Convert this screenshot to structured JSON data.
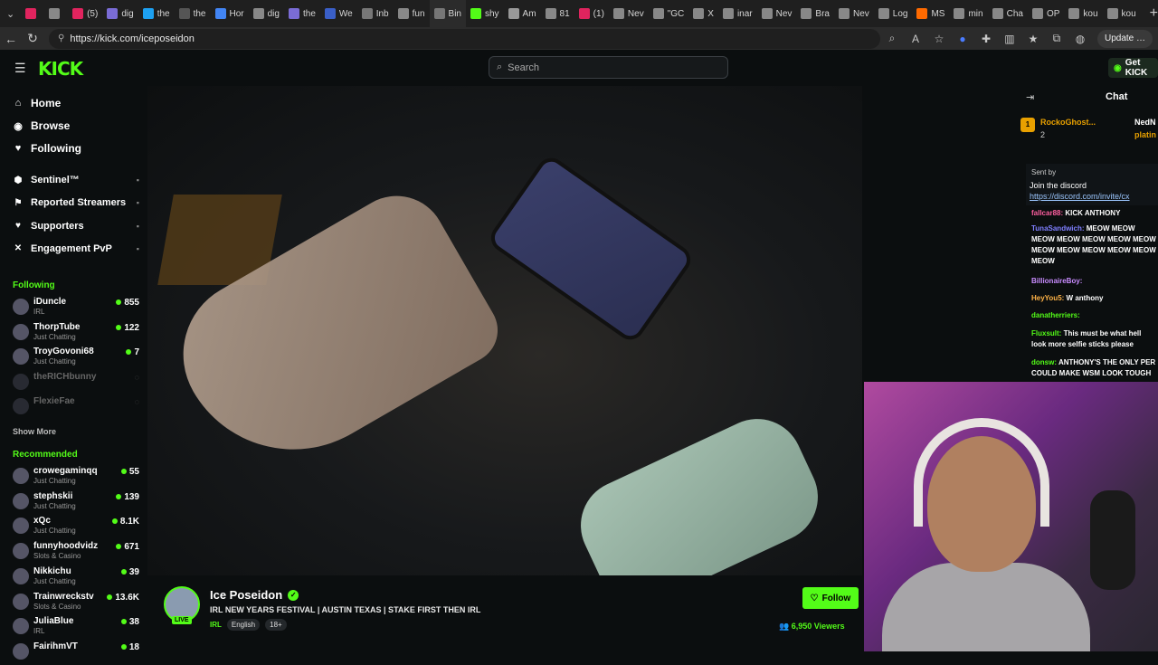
{
  "browser": {
    "tabs": [
      {
        "label": "",
        "color": "#e0245e"
      },
      {
        "label": "",
        "color": "#888"
      },
      {
        "label": "(5)",
        "color": "#e0245e"
      },
      {
        "label": "dig",
        "color": "#7a6cd6"
      },
      {
        "label": "the",
        "color": "#1da1f2"
      },
      {
        "label": "the",
        "color": "#555"
      },
      {
        "label": "Hor",
        "color": "#4285f4"
      },
      {
        "label": "dig",
        "color": "#888"
      },
      {
        "label": "the",
        "color": "#7a6cd6"
      },
      {
        "label": "We",
        "color": "#3a5fc8"
      },
      {
        "label": "Inb",
        "color": "#777"
      },
      {
        "label": "fun",
        "color": "#888"
      },
      {
        "label": "Bin",
        "color": "#777"
      },
      {
        "label": "shy",
        "color": "#53fc18"
      },
      {
        "label": "Am",
        "color": "#999"
      },
      {
        "label": "81",
        "color": "#888"
      },
      {
        "label": "(1)",
        "color": "#e0245e"
      },
      {
        "label": "Nev",
        "color": "#888"
      },
      {
        "label": "\"GC",
        "color": "#888"
      },
      {
        "label": "X",
        "color": "#888"
      },
      {
        "label": "inar",
        "color": "#888"
      },
      {
        "label": "Nev",
        "color": "#888"
      },
      {
        "label": "Bra",
        "color": "#888"
      },
      {
        "label": "Nev",
        "color": "#888"
      },
      {
        "label": "Log",
        "color": "#888"
      },
      {
        "label": "MS",
        "color": "#ff6a00"
      },
      {
        "label": "min",
        "color": "#888"
      },
      {
        "label": "Cha",
        "color": "#888"
      },
      {
        "label": "OP",
        "color": "#888"
      },
      {
        "label": "kou",
        "color": "#888"
      },
      {
        "label": "kou",
        "color": "#888"
      }
    ],
    "url": "https://kick.com/iceposeidon",
    "update_label": "Update"
  },
  "header": {
    "logo": "KICK",
    "search_placeholder": "Search",
    "get_kick_label": "Get KICK"
  },
  "sidebar": {
    "nav": [
      {
        "label": "Home",
        "icon": "home-icon",
        "glyph": "⌂"
      },
      {
        "label": "Browse",
        "icon": "browse-icon",
        "glyph": "◉"
      },
      {
        "label": "Following",
        "icon": "heart-icon",
        "glyph": "♥"
      }
    ],
    "special": [
      {
        "label": "Sentinel™",
        "glyph": "⬢"
      },
      {
        "label": "Reported Streamers",
        "glyph": "⚑"
      },
      {
        "label": "Supporters",
        "glyph": "♥"
      },
      {
        "label": "Engagement PvP",
        "glyph": "✕"
      }
    ],
    "following_header": "Following",
    "following": [
      {
        "name": "iDuncle",
        "category": "IRL",
        "viewers": "855",
        "live": true
      },
      {
        "name": "ThorpTube",
        "category": "Just Chatting",
        "viewers": "122",
        "live": true
      },
      {
        "name": "TroyGovoni68",
        "category": "Just Chatting",
        "viewers": "7",
        "live": true
      },
      {
        "name": "theRICHbunny",
        "category": "",
        "viewers": "",
        "live": false
      },
      {
        "name": "FlexieFae",
        "category": "",
        "viewers": "",
        "live": false
      }
    ],
    "show_more": "Show More",
    "recommended_header": "Recommended",
    "recommended": [
      {
        "name": "crowegaminqq",
        "category": "Just Chatting",
        "viewers": "55"
      },
      {
        "name": "stephskii",
        "category": "Just Chatting",
        "viewers": "139"
      },
      {
        "name": "xQc",
        "category": "Just Chatting",
        "viewers": "8.1K"
      },
      {
        "name": "funnyhoodvidz",
        "category": "Slots & Casino",
        "viewers": "671"
      },
      {
        "name": "Nikkichu",
        "category": "Just Chatting",
        "viewers": "39"
      },
      {
        "name": "Trainwreckstv",
        "category": "Slots & Casino",
        "viewers": "13.6K"
      },
      {
        "name": "JuliaBlue",
        "category": "IRL",
        "viewers": "38"
      },
      {
        "name": "FairihmVT",
        "category": "",
        "viewers": "18"
      }
    ]
  },
  "stream": {
    "name": "Ice Poseidon",
    "title": "IRL NEW YEARS FESTIVAL | AUSTIN TEXAS | STAKE FIRST THEN IRL",
    "category": "IRL",
    "tags": [
      "English",
      "18+"
    ],
    "live_label": "LIVE",
    "follow_label": "Follow",
    "viewers": "6,950 Viewers"
  },
  "chat": {
    "title": "Chat",
    "gifters": [
      {
        "name": "RockoGhost...",
        "count": "2"
      },
      {
        "name": "NedN",
        "count": ""
      },
      {
        "name": "platin",
        "count": ""
      }
    ],
    "pinned": {
      "sent_by": "Sent by",
      "sender": "",
      "text": "Join the discord",
      "link": "https://discord.com/invite/cx"
    },
    "messages": [
      {
        "user": "fallcar88:",
        "user_color": "#ff5fa0",
        "text": "KICK ANTHONY"
      },
      {
        "user": "TunaSandwich:",
        "user_color": "#7f7fff",
        "text": "MEOW MEOW MEOW MEOW MEOW MEOW MEOW MEOW MEOW MEOW MEOW MEOW MEOW"
      },
      {
        "user": "BillionaireBoy:",
        "user_color": "#c98cff",
        "text": ""
      },
      {
        "user": "HeyYou5:",
        "user_color": "#ffb347",
        "text": "W anthony"
      },
      {
        "user": "danatherriers:",
        "user_color": "#53fc18",
        "text": ""
      },
      {
        "user": "Fluxsult:",
        "user_color": "#53fc18",
        "text": "This must be what hell look more selfie sticks please"
      },
      {
        "user": "donsw:",
        "user_color": "#53fc18",
        "text": "ANTHONY'S THE ONLY PER COULD MAKE WSM LOOK TOUGH"
      }
    ]
  }
}
